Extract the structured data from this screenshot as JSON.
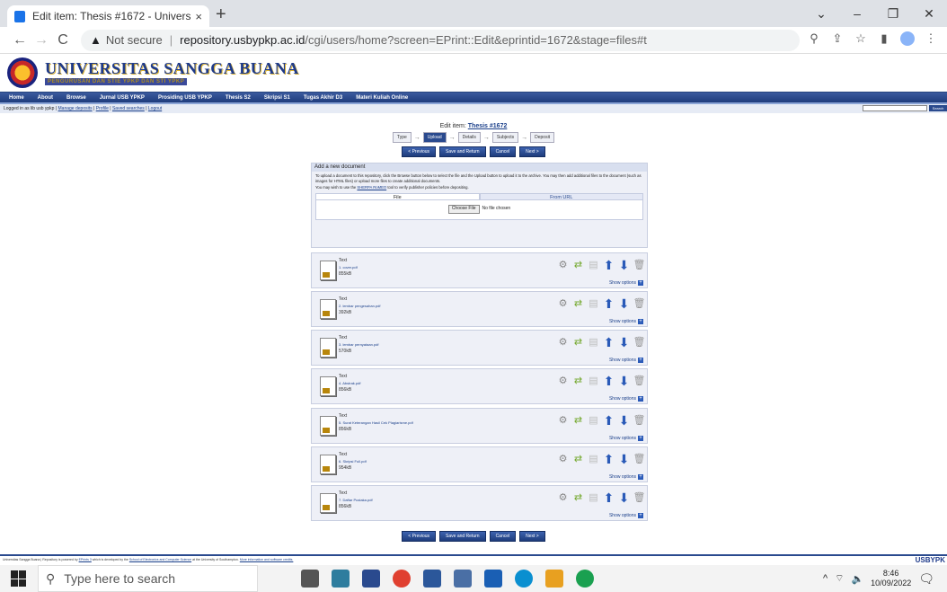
{
  "browser": {
    "tab_title": "Edit item: Thesis #1672 - Univers",
    "close": "×",
    "new_tab": "+",
    "min": "⌄",
    "minimize": "–",
    "maximize": "❐",
    "close_win": "✕",
    "back": "←",
    "forward": "→",
    "reload": "C",
    "warning": "▲",
    "not_secure": "Not secure",
    "host": "repository.usbypkp.ac.id",
    "path": "/cgi/users/home?screen=EPrint::Edit&eprintid=1672&stage=files#t"
  },
  "site": {
    "brand": "UNIVERSITAS SANGGA BUANA",
    "brand_sub": "PENGURUSAN DAN STIE YPKP DAN STI YPKP",
    "menu": [
      "Home",
      "About",
      "Browse",
      "Jurnal USB YPKP",
      "Prosiding USB YPKP",
      "Thesis S2",
      "Skripsi S1",
      "Tugas Akhir D3",
      "Materi Kuliah Online"
    ],
    "login_text": "Logged in as lib usb ypkp |",
    "login_links": [
      "Manage deposits",
      "Profile",
      "Saved searches",
      "Logout"
    ],
    "search_btn": "Search"
  },
  "edit": {
    "title_prefix": "Edit item:",
    "title_link": "Thesis #1672",
    "steps": [
      "Type",
      "Upload",
      "Details",
      "Subjects",
      "Deposit"
    ],
    "buttons": [
      "< Previous",
      "Save and Return",
      "Cancel",
      "Next >"
    ]
  },
  "add_doc": {
    "heading": "Add a new document",
    "desc": "To upload a document to this repository, click the Browse button below to select the file and the Upload button to upload it to the archive. You may then add additional files to the document (such as images for HTML files) or upload more files to create additional documents.",
    "sherpa_pre": "You may wish to use the",
    "sherpa_link": "SHERPA RoMEO",
    "sherpa_post": "tool to verify publisher policies before depositing.",
    "tab_file": "File",
    "tab_url": "From URL",
    "choose": "Choose File",
    "no_file": "No file chosen"
  },
  "docs": [
    {
      "type": "Text",
      "file": "1. cover.pdf",
      "size": "855kB"
    },
    {
      "type": "Text",
      "file": "2. lembar pengesahan.pdf",
      "size": "392kB"
    },
    {
      "type": "Text",
      "file": "3. lembar pernyataan.pdf",
      "size": "570kB"
    },
    {
      "type": "Text",
      "file": "4. Abstrak.pdf",
      "size": "856kB"
    },
    {
      "type": "Text",
      "file": "5. Surat Keterangan Hasil Cek Plagiarisme.pdf",
      "size": "856kB"
    },
    {
      "type": "Text",
      "file": "6. Skripsi Full.pdf",
      "size": "954kB"
    },
    {
      "type": "Text",
      "file": "7. Daftar Pustaka.pdf",
      "size": "856kB"
    }
  ],
  "show_options": "Show options",
  "footer": {
    "text": "Universitas Sangga Buana | Repository is powered by",
    "eprints": "EPrints 3",
    "text2": "which is developed by the",
    "school": "School of Electronics and Computer Science",
    "text3": "at the University of Southampton.",
    "more": "More information and software credits.",
    "logo": "USBYPK"
  },
  "taskbar": {
    "search": "Type here to search",
    "time": "8:46",
    "date": "10/09/2022"
  }
}
